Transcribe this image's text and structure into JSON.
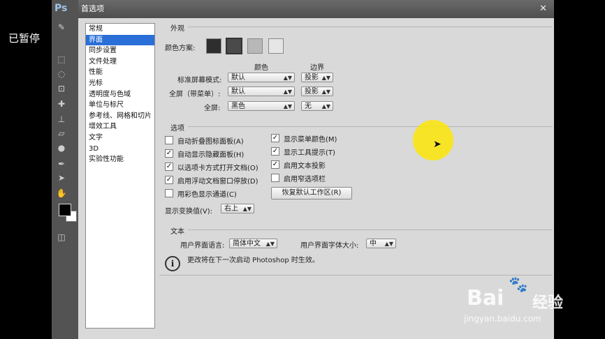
{
  "overlay": {
    "paused_label": "已暂停"
  },
  "app": {
    "logo": "Ps"
  },
  "dialog": {
    "title": "首选项"
  },
  "nav": {
    "items": [
      "常规",
      "界面",
      "同步设置",
      "文件处理",
      "性能",
      "光标",
      "透明度与色域",
      "单位与标尺",
      "参考线、网格和切片",
      "增效工具",
      "文字",
      "3D",
      "实验性功能"
    ],
    "selected": "界面"
  },
  "appearance": {
    "section_title": "外观",
    "color_scheme_label": "颜色方案:",
    "color_scheme_swatches": [
      "#2e2e2e",
      "#4a4a4a",
      "#b8b8b8",
      "#e6e6e6"
    ],
    "col_color": "颜色",
    "col_border": "边界",
    "rows": [
      {
        "label": "标准屏幕模式:",
        "color": "默认",
        "border": "投影"
      },
      {
        "label": "全屏（带菜单）:",
        "color": "默认",
        "border": "投影"
      },
      {
        "label": "全屏:",
        "color": "黑色",
        "border": "无"
      }
    ]
  },
  "options": {
    "section_title": "选项",
    "left_checks": [
      {
        "label": "自动折叠图标面板(A)",
        "checked": false
      },
      {
        "label": "自动显示隐藏面板(H)",
        "checked": true
      },
      {
        "label": "以选项卡方式打开文档(O)",
        "checked": true
      },
      {
        "label": "启用浮动文档窗口停放(D)",
        "checked": true
      },
      {
        "label": "用彩色显示通道(C)",
        "checked": false
      }
    ],
    "right_checks": [
      {
        "label": "显示菜单颜色(M)",
        "checked": true
      },
      {
        "label": "显示工具提示(T)",
        "checked": true
      },
      {
        "label": "启用文本投影",
        "checked": true
      },
      {
        "label": "启用窄选项栏",
        "checked": false
      }
    ],
    "reset_button": "恢复默认工作区(R)",
    "transform_label": "显示变换值(V):",
    "transform_value": "右上"
  },
  "text": {
    "section_title": "文本",
    "ui_language_label": "用户界面语言:",
    "ui_language_value": "简体中文",
    "ui_font_size_label": "用户界面字体大小:",
    "ui_font_size_value": "中",
    "info_note": "更改将在下一次启动 Photoshop 时生效。"
  },
  "watermark": {
    "brand": "Bai",
    "brand2": "经验",
    "url": "jingyan.baidu.com"
  }
}
